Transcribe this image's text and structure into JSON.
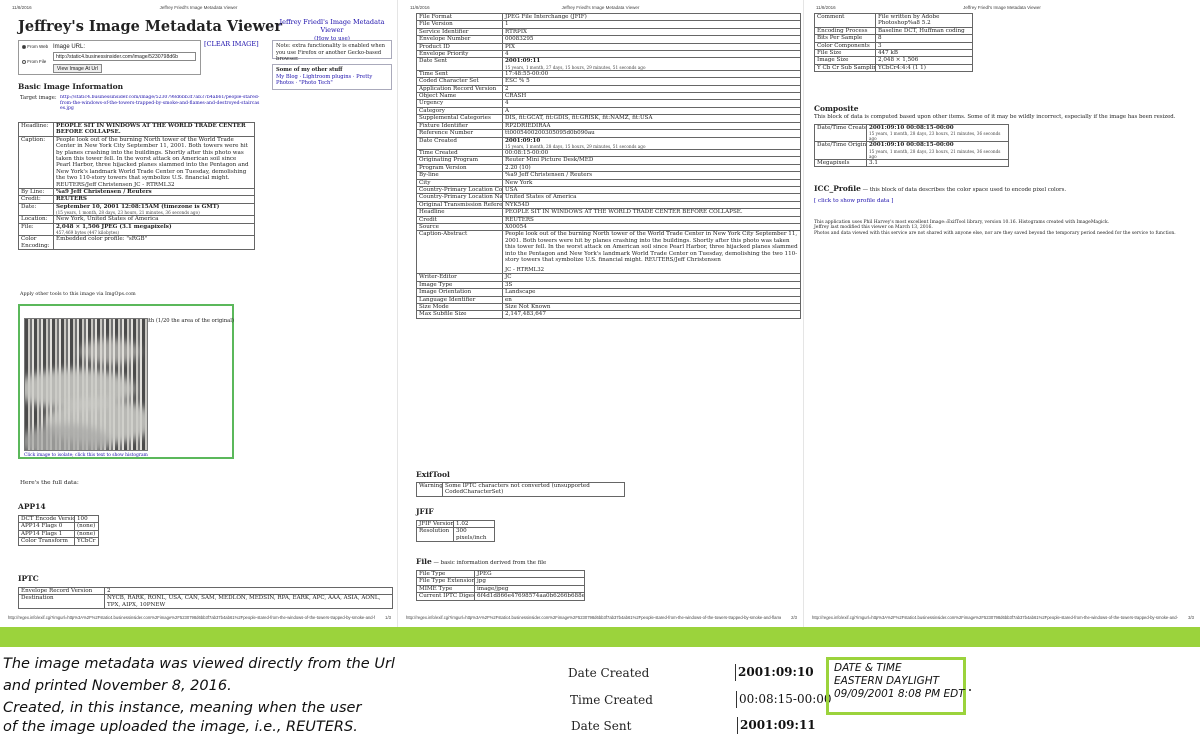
{
  "pages": [
    {
      "date": "11/8/2016",
      "title": "Jeffrey Friedl's Image Metadata Viewer",
      "footer_url": "http://regex.info/exif.cgi?imgurl=http%3A%2F%2Fstatic4.businessinsider.com%2Fimage%2F5230798d6bb3f7ab37b4ab61%2Fpeople-stared-from-the-windows-of-the-towers-trapped-by-smoke-and-flames-and-d...",
      "page_num": "1/3"
    },
    {
      "date": "11/8/2016",
      "title": "Jeffrey Friedl's Image Metadata Viewer",
      "footer_url": "http://regex.info/exif.cgi?imgurl=http%3A%2F%2Fstatic4.businessinsider.com%2Fimage%2F5230798d6bb3f7ab37b4ab61%2Fpeople-stared-from-the-windows-of-the-towers-trapped-by-smoke-and-flames-and-d...",
      "page_num": "2/3"
    },
    {
      "date": "11/8/2016",
      "title": "Jeffrey Friedl's Image Metadata Viewer",
      "footer_url": "http://regex.info/exif.cgi?imgurl=http%3A%2F%2Fstatic4.businessinsider.com%2Fimage%2F5230798d6bb3f7ab37b4ab61%2Fpeople-stared-from-the-windows-of-the-towers-trapped-by-smoke-and-flames-and-d...",
      "page_num": "3/3"
    }
  ],
  "viewer": {
    "title": "Jeffrey's Image Metadata Viewer",
    "clear": "[CLEAR IMAGE]",
    "from_web": "From Web",
    "from_file": "From File",
    "url_label": "Image URL:",
    "url_value": "http://static4.businessinsider.com/image/5230798d6b",
    "view_button": "View Image At Url",
    "side_title": "Jeffrey Friedl's Image Metadata Viewer",
    "side_howto": "(How to use)",
    "side_note": "Note: extra functionality is enabled when you use Firefox or another Gecko-based browser.",
    "other_title": "Some of my other stuff",
    "other_links": "My Blog · Lightroom plugins · Pretty Photos · \"Photo Tech\"",
    "basic_heading": "Basic Image Information",
    "target_label": "Target image:",
    "target_url": "http://static4.businessinsider.com/image/5230798d6bb3f7ab37b4ab61/people-stared-from-the-windows-of-the-towers-trapped-by-smoke-and-flames-and-destroyed-staircases.jpg",
    "apply_tools": "Apply other tools to this image via ImgOps.com",
    "photo_caption": "Main image displayed here at 22% width (1/20 the area of the original)",
    "photo_note": "Click image to isolate; click this text to show histogram",
    "full_data": "Here's the full data:",
    "app14": "APP14",
    "iptc": "IPTC"
  },
  "basic": [
    {
      "k": "Headline:",
      "v": "PEOPLE SIT IN WINDOWS AT THE WORLD TRADE CENTER BEFORE COLLAPSE.",
      "bold": true
    },
    {
      "k": "Caption:",
      "v": "People look out of the burning North tower of the World Trade Center in New York City September 11, 2001. Both towers were hit by planes crashing into the buildings. Shortly after this photo was taken this tower fell. In the worst attack on American soil since Pearl Harbor, three hijacked planes slammed into the Pentagon and New York's landmark World Trade Center on Tuesday, demolishing the two 110-story towers that symbolize U.S. financial might. REUTERS/Jeff Christensen  JC - RTRML32"
    },
    {
      "k": "By Line:",
      "v": "%a9 Jeff Christensen / Reuters",
      "bold": true
    },
    {
      "k": "Credit:",
      "v": "REUTERS",
      "bold": true
    },
    {
      "k": "Date:",
      "v": "September 10, 2001   12:08:15AM (timezone is GMT)",
      "bold": true,
      "sub": "(15 years, 1 month, 28 days, 23 hours, 21 minutes, 36 seconds ago)"
    },
    {
      "k": "Location:",
      "v": "New York, United States of America"
    },
    {
      "k": "File:",
      "v": "2,048 × 1,506 JPEG (3.1 megapixels)",
      "bold": true,
      "sub": "457,469 bytes (447 kilobytes)"
    },
    {
      "k": "Color Encoding:",
      "v": "Embedded color profile: \"sRGB\""
    }
  ],
  "app14_rows": [
    {
      "k": "DCT Encode Version",
      "v": "100"
    },
    {
      "k": "APP14 Flags 0",
      "v": "(none)"
    },
    {
      "k": "APP14 Flags 1",
      "v": "(none)"
    },
    {
      "k": "Color Transform",
      "v": "YCbCr"
    }
  ],
  "iptc_rows": [
    {
      "k": "Envelope Record Version",
      "v": "2"
    },
    {
      "k": "Destination",
      "v": "NYCB, RARK, RONL, USA, CAN, SAM, MEDLON, MEDSIN, RPA, EARK, APC, AAA, ASIA, AONL, TPX, AIPX, 10PNEW"
    }
  ],
  "p2_rows": [
    {
      "k": "File Format",
      "v": "JPEG File Interchange (JFIF)"
    },
    {
      "k": "File Version",
      "v": "1"
    },
    {
      "k": "Service Identifier",
      "v": "RTRPIX"
    },
    {
      "k": "Envelope Number",
      "v": "00083295"
    },
    {
      "k": "Product ID",
      "v": "PIX"
    },
    {
      "k": "Envelope Priority",
      "v": "4"
    },
    {
      "k": "Date Sent",
      "v": "2001:09:11",
      "bold": true,
      "sub": "15 years, 1 month, 27 days, 15 hours, 29 minutes, 51 seconds ago"
    },
    {
      "k": "Time Sent",
      "v": "17:48:55-00:00"
    },
    {
      "k": "Coded Character Set",
      "v": "ESC % 5"
    },
    {
      "k": "Application Record Version",
      "v": "2"
    },
    {
      "k": "Object Name",
      "v": "CRASH"
    },
    {
      "k": "Urgency",
      "v": "4"
    },
    {
      "k": "Category",
      "v": "A"
    },
    {
      "k": "Supplemental Categories",
      "v": "DIS, fit:GCAT, fit:GDIS, fit:GRISK, fit:NAMZ, fit:USA"
    },
    {
      "k": "Fixture Identifier",
      "v": "RP2DRIEDIRAA"
    },
    {
      "k": "Reference Number",
      "v": "tt0005400200305095d0b090au"
    },
    {
      "k": "Date Created",
      "v": "2001:09:10",
      "bold": true,
      "sub": "15 years, 1 month, 28 days, 15 hours, 29 minutes, 51 seconds ago"
    },
    {
      "k": "Time Created",
      "v": "00:08:15-00:00"
    },
    {
      "k": "Originating Program",
      "v": "Reuter Mini Picture Desk/MED"
    },
    {
      "k": "Program Version",
      "v": "2.20 (10)"
    },
    {
      "k": "By-line",
      "v": "%a9 Jeff Christensen / Reuters"
    },
    {
      "k": "City",
      "v": "New York"
    },
    {
      "k": "Country-Primary Location Code",
      "v": "USA"
    },
    {
      "k": "Country-Primary Location Name",
      "v": "United States of America"
    },
    {
      "k": "Original Transmission Reference",
      "v": "NYK54D"
    },
    {
      "k": "Headline",
      "v": "PEOPLE SIT IN WINDOWS AT THE WORLD TRADE CENTER BEFORE COLLAPSE."
    },
    {
      "k": "Credit",
      "v": "REUTERS"
    },
    {
      "k": "Source",
      "v": "X00054"
    },
    {
      "k": "Caption-Abstract",
      "v": "People look out of the burning North tower of the World Trade Center in New York City September 11, 2001. Both towers were hit by planes crashing into the buildings. Shortly after this photo was taken this tower fell. In the worst attack on American soil since Pearl Harbor, three hijacked planes slammed into the Pentagon and New York's landmark World Trade Center on Tuesday, demolishing the two 110-story towers that symbolize U.S. financial might. REUTERS/Jeff Christensen",
      "sub": "JC - RTRML32",
      "tall": true
    },
    {
      "k": "Writer-Editor",
      "v": "JC"
    },
    {
      "k": "Image Type",
      "v": "3S"
    },
    {
      "k": "Image Orientation",
      "v": "Landscape"
    },
    {
      "k": "Language Identifier",
      "v": "en"
    },
    {
      "k": "Size Mode",
      "v": "Size Not Known"
    },
    {
      "k": "Max Subfile Size",
      "v": "2,147,483,647"
    }
  ],
  "exiftool": {
    "heading": "ExifTool",
    "k": "Warning",
    "v": "Some IPTC characters not converted (unsupported CodedCharacterSet)"
  },
  "jfif": {
    "heading": "JFIF",
    "rows": [
      {
        "k": "JFIF Version",
        "v": "1.02"
      },
      {
        "k": "Resolution",
        "v": "300 pixels/inch"
      }
    ]
  },
  "file_section": {
    "heading": "File",
    "desc": " — basic information derived from the file",
    "rows": [
      {
        "k": "File Type",
        "v": "JPEG"
      },
      {
        "k": "File Type Extension",
        "v": "jpg"
      },
      {
        "k": "MIME Type",
        "v": "image/jpeg"
      },
      {
        "k": "Current IPTC Digest",
        "v": "6f4d1d866e47698574aa0b6266b688e488"
      }
    ]
  },
  "p3_rows": [
    {
      "k": "Comment",
      "v": "File written by Adobe Photoshop%a8 5.2"
    },
    {
      "k": "Encoding Process",
      "v": "Baseline DCT, Huffman coding"
    },
    {
      "k": "Bits Per Sample",
      "v": "8"
    },
    {
      "k": "Color Components",
      "v": "3"
    },
    {
      "k": "File Size",
      "v": "447 kB"
    },
    {
      "k": "Image Size",
      "v": "2,048 × 1,506"
    },
    {
      "k": "Y Cb Cr Sub Sampling",
      "v": "YCbCr4:4:4 (1 1)"
    }
  ],
  "composite": {
    "heading": "Composite",
    "desc": "This block of data is computed based upon other items. Some of it may be wildly incorrect, especially if the image has been resized.",
    "rows": [
      {
        "k": "Date/Time Created",
        "v": "2001:09:10 00:08:15-00:00",
        "bold": true,
        "sub": "15 years, 1 month, 28 days, 23 hours, 21 minutes, 36 seconds ago"
      },
      {
        "k": "Date/Time Original",
        "v": "2001:09:10 00:08:15-00:00",
        "bold": true,
        "sub": "15 years, 1 month, 28 days, 23 hours, 21 minutes, 36 seconds ago"
      },
      {
        "k": "Megapixels",
        "v": "3.1"
      }
    ]
  },
  "icc": {
    "heading": "ICC_Profile",
    "desc": " — this block of data describes the color space used to encode pixel colors.",
    "link": "[ click to show profile data ]"
  },
  "credits": {
    "line1": "This application uses Phil Harvey's most excellent Image::ExifTool library, version 10.16. Histograms created with ImageMagick.",
    "line2": "Jeffrey last modified this viewer on March 13, 2016.",
    "line3": "Photos and data viewed with this service are not shared with anyone else, nor are they saved beyond the temporary period needed for the service to function."
  },
  "annotation": {
    "lines": [
      "The image metadata was viewed directly from the Url",
      "and printed November 8, 2016.",
      "Created, in this instance, meaning when the user",
      "of the image uploaded the image, i.e., REUTERS."
    ],
    "items": [
      {
        "label": "Date Created",
        "value": "2001:09:10"
      },
      {
        "label": "Time Created",
        "value": "00:08:15-00:00"
      },
      {
        "label": "Date Sent",
        "value": "2001:09:11"
      }
    ],
    "stamp": [
      "DATE & TIME",
      "EASTERN DAYLIGHT",
      "09/09/2001 8:08 PM EDT"
    ],
    "accent": "#9bd33c"
  }
}
